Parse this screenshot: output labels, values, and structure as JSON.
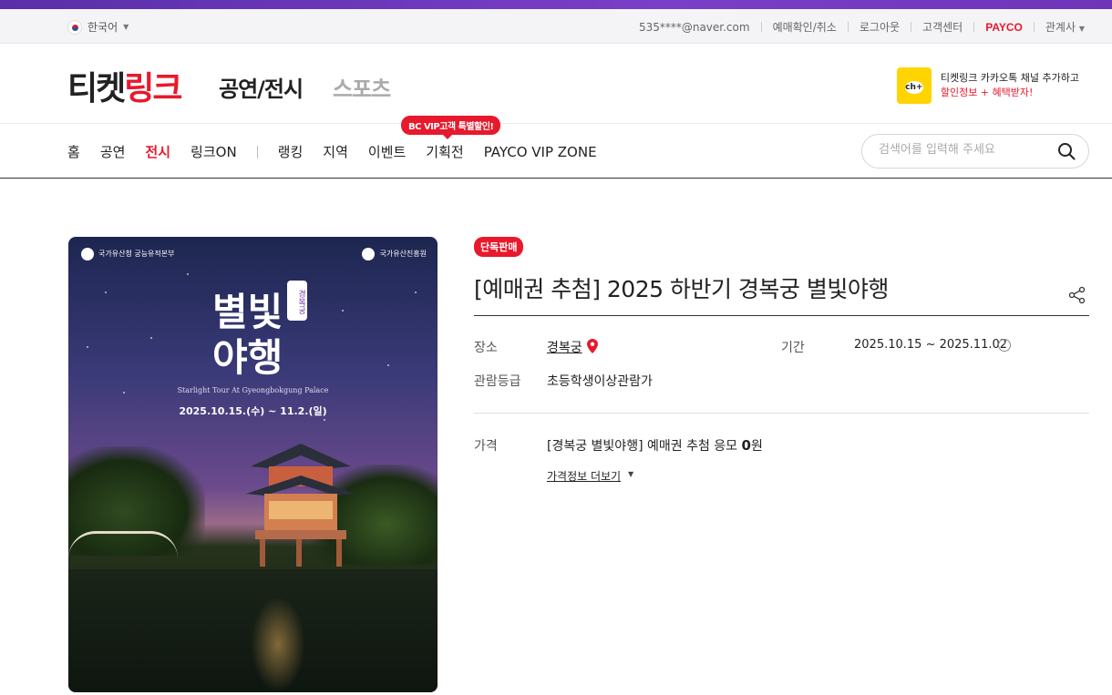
{
  "utility": {
    "language": "한국어",
    "account": "535****@naver.com",
    "links": [
      "예매확인/취소",
      "로그아웃",
      "고객센터"
    ],
    "payco": "PAYCO",
    "related": "관계사"
  },
  "header": {
    "logo_black": "티켓",
    "logo_red": "링크",
    "tabs": [
      "공연/전시",
      "스포츠"
    ],
    "kakao_line1": "티켓링크 카카오톡 채널 추가하고",
    "kakao_line2": "할인정보 + 혜택받자!"
  },
  "nav": {
    "items_left": [
      "홈",
      "공연",
      "전시",
      "링크ON"
    ],
    "items_right": [
      "랭킹",
      "지역",
      "이벤트",
      "기획전",
      "PAYCO VIP ZONE"
    ],
    "active": "전시",
    "promo_badge": "BC VIP고객 특별할인!"
  },
  "search": {
    "placeholder": "검색어를 입력해 주세요"
  },
  "poster": {
    "agency_left": "국가유산청 궁능유적본부",
    "agency_right": "국가유산진흥원",
    "title_line1": "별빛",
    "title_line2": "야행",
    "tag": "경복궁",
    "english": "Starlight Tour At Gyeongbokgung Palace",
    "dates": "2025.10.15.(수) ~ 11.2.(일)"
  },
  "product": {
    "badge": "단독판매",
    "title": "[예매권 추첨] 2025 하반기 경복궁 별빛야행",
    "venue_label": "장소",
    "venue": "경복궁",
    "period_label": "기간",
    "period": "2025.10.15 ~ 2025.11.02",
    "rating_label": "관람등급",
    "rating": "초등학생이상관람가",
    "price_label": "가격",
    "price_text": "[경복궁 별빛야행] 예매권 추첨 응모",
    "price_amount": "0",
    "price_unit": "원",
    "more_price": "가격정보 더보기"
  },
  "colors": {
    "accent": "#e8192c",
    "topbar": "#6d35b8"
  }
}
